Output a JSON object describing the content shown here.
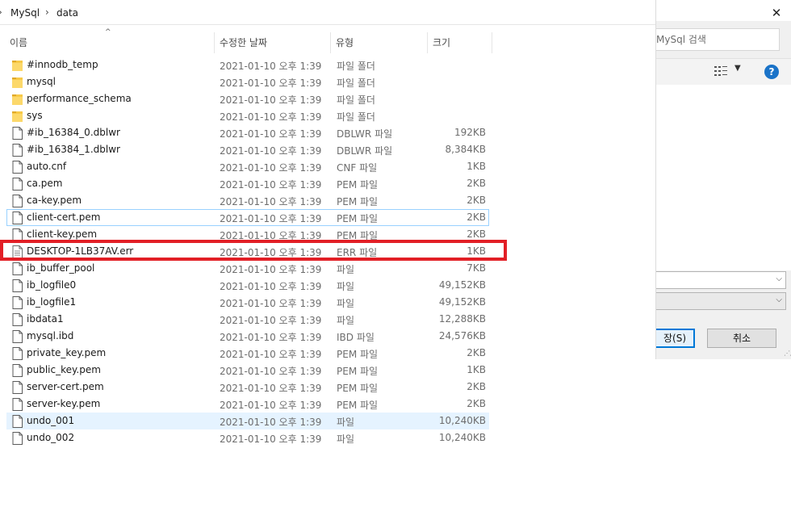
{
  "breadcrumb": {
    "items": [
      "MySql",
      "data"
    ]
  },
  "columns": {
    "name": "이름",
    "date": "수정한 날짜",
    "type": "유형",
    "size": "크기"
  },
  "files": [
    {
      "name": "#innodb_temp",
      "date": "2021-01-10 오후 1:39",
      "type": "파일 폴더",
      "size": "",
      "kind": "folder"
    },
    {
      "name": "mysql",
      "date": "2021-01-10 오후 1:39",
      "type": "파일 폴더",
      "size": "",
      "kind": "folder"
    },
    {
      "name": "performance_schema",
      "date": "2021-01-10 오후 1:39",
      "type": "파일 폴더",
      "size": "",
      "kind": "folder"
    },
    {
      "name": "sys",
      "date": "2021-01-10 오후 1:39",
      "type": "파일 폴더",
      "size": "",
      "kind": "folder"
    },
    {
      "name": "#ib_16384_0.dblwr",
      "date": "2021-01-10 오후 1:39",
      "type": "DBLWR 파일",
      "size": "192KB",
      "kind": "file"
    },
    {
      "name": "#ib_16384_1.dblwr",
      "date": "2021-01-10 오후 1:39",
      "type": "DBLWR 파일",
      "size": "8,384KB",
      "kind": "file"
    },
    {
      "name": "auto.cnf",
      "date": "2021-01-10 오후 1:39",
      "type": "CNF 파일",
      "size": "1KB",
      "kind": "file"
    },
    {
      "name": "ca.pem",
      "date": "2021-01-10 오후 1:39",
      "type": "PEM 파일",
      "size": "2KB",
      "kind": "file"
    },
    {
      "name": "ca-key.pem",
      "date": "2021-01-10 오후 1:39",
      "type": "PEM 파일",
      "size": "2KB",
      "kind": "file"
    },
    {
      "name": "client-cert.pem",
      "date": "2021-01-10 오후 1:39",
      "type": "PEM 파일",
      "size": "2KB",
      "kind": "file",
      "state": "focused"
    },
    {
      "name": "client-key.pem",
      "date": "2021-01-10 오후 1:39",
      "type": "PEM 파일",
      "size": "2KB",
      "kind": "file"
    },
    {
      "name": "DESKTOP-1LB37AV.err",
      "date": "2021-01-10 오후 1:39",
      "type": "ERR 파일",
      "size": "1KB",
      "kind": "text"
    },
    {
      "name": "ib_buffer_pool",
      "date": "2021-01-10 오후 1:39",
      "type": "파일",
      "size": "7KB",
      "kind": "file"
    },
    {
      "name": "ib_logfile0",
      "date": "2021-01-10 오후 1:39",
      "type": "파일",
      "size": "49,152KB",
      "kind": "file"
    },
    {
      "name": "ib_logfile1",
      "date": "2021-01-10 오후 1:39",
      "type": "파일",
      "size": "49,152KB",
      "kind": "file"
    },
    {
      "name": "ibdata1",
      "date": "2021-01-10 오후 1:39",
      "type": "파일",
      "size": "12,288KB",
      "kind": "file"
    },
    {
      "name": "mysql.ibd",
      "date": "2021-01-10 오후 1:39",
      "type": "IBD 파일",
      "size": "24,576KB",
      "kind": "file"
    },
    {
      "name": "private_key.pem",
      "date": "2021-01-10 오후 1:39",
      "type": "PEM 파일",
      "size": "2KB",
      "kind": "file"
    },
    {
      "name": "public_key.pem",
      "date": "2021-01-10 오후 1:39",
      "type": "PEM 파일",
      "size": "1KB",
      "kind": "file"
    },
    {
      "name": "server-cert.pem",
      "date": "2021-01-10 오후 1:39",
      "type": "PEM 파일",
      "size": "2KB",
      "kind": "file"
    },
    {
      "name": "server-key.pem",
      "date": "2021-01-10 오후 1:39",
      "type": "PEM 파일",
      "size": "2KB",
      "kind": "file"
    },
    {
      "name": "undo_001",
      "date": "2021-01-10 오후 1:39",
      "type": "파일",
      "size": "10,240KB",
      "kind": "file",
      "state": "selected"
    },
    {
      "name": "undo_002",
      "date": "2021-01-10 오후 1:39",
      "type": "파일",
      "size": "10,240KB",
      "kind": "file"
    }
  ],
  "background_dialog": {
    "search_placeholder": "MySql 검색",
    "save_label": "장(S)",
    "cancel_label": "취소"
  },
  "icons": {
    "close": "close-icon",
    "view": "view-options-icon",
    "help": "help-icon",
    "folder": "folder-icon",
    "file": "file-icon",
    "text": "text-file-icon"
  },
  "colors": {
    "highlight": "#e21f26",
    "selected_bg": "#e5f3ff",
    "focus_border": "#99d1ff",
    "folder": "#f7c948",
    "accent": "#0078d7"
  }
}
